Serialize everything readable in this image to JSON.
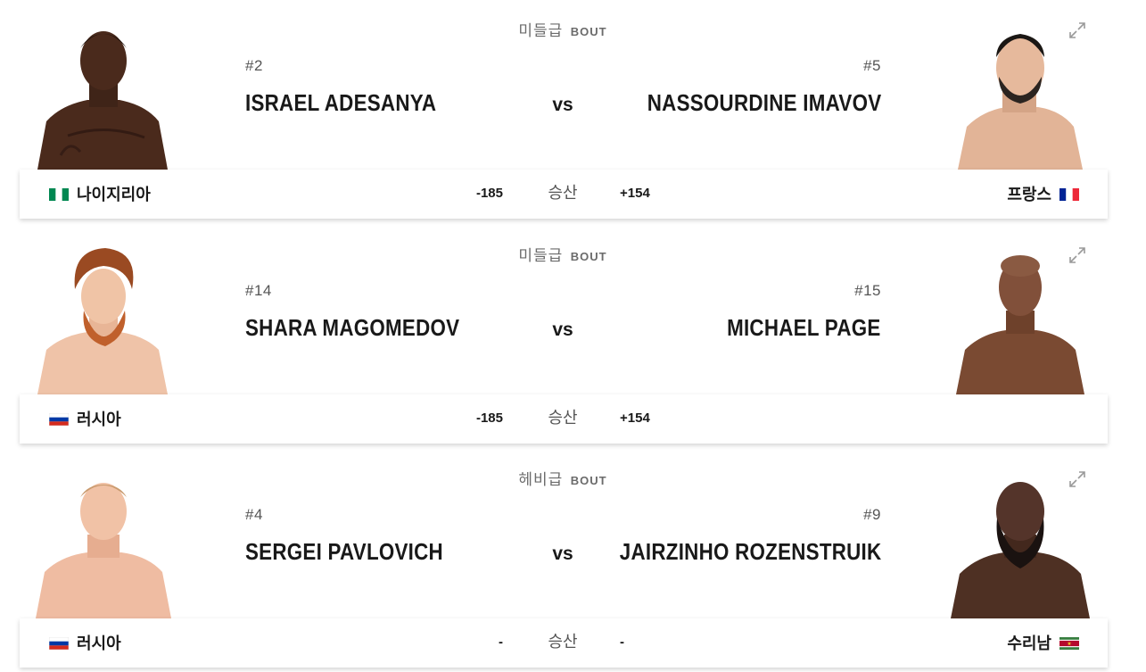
{
  "bouts": [
    {
      "weight_class": "미들급",
      "bout_label": "BOUT",
      "vs_label": "vs",
      "odds_label": "승산",
      "red": {
        "rank": "#2",
        "name": "ISRAEL ADESANYA",
        "country": "나이지리아",
        "flag": "nigeria-flag-icon",
        "odds": "-185"
      },
      "blue": {
        "rank": "#5",
        "name": "NASSOURDINE IMAVOV",
        "country": "프랑스",
        "flag": "france-flag-icon",
        "odds": "+154"
      }
    },
    {
      "weight_class": "미들급",
      "bout_label": "BOUT",
      "vs_label": "vs",
      "odds_label": "승산",
      "red": {
        "rank": "#14",
        "name": "SHARA MAGOMEDOV",
        "country": "러시아",
        "flag": "russia-flag-icon",
        "odds": "-185"
      },
      "blue": {
        "rank": "#15",
        "name": "MICHAEL PAGE",
        "country": "",
        "flag": "",
        "odds": "+154"
      }
    },
    {
      "weight_class": "헤비급",
      "bout_label": "BOUT",
      "vs_label": "vs",
      "odds_label": "승산",
      "red": {
        "rank": "#4",
        "name": "SERGEI PAVLOVICH",
        "country": "러시아",
        "flag": "russia-flag-icon",
        "odds": "-"
      },
      "blue": {
        "rank": "#9",
        "name": "JAIRZINHO ROZENSTRUIK",
        "country": "수리남",
        "flag": "suriname-flag-icon",
        "odds": "-"
      }
    }
  ],
  "colors": {
    "text": "#191919",
    "muted": "#6b6b6b",
    "bar_shadow": "rgba(0,0,0,0.18)"
  }
}
